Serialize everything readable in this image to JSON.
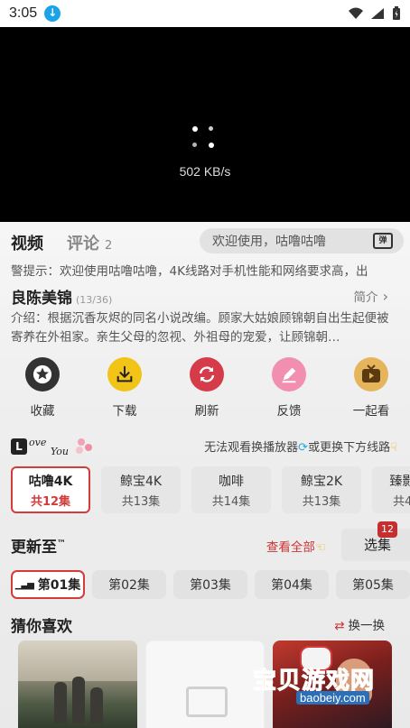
{
  "status_bar": {
    "time": "3:05"
  },
  "player": {
    "speed": "502 KB/s"
  },
  "tabs": {
    "video": "视频",
    "comments": "评论",
    "comments_count": "2"
  },
  "danmu": {
    "placeholder": "欢迎使用，咕噜咕噜",
    "icon_text": "弹"
  },
  "notice": "警提示：欢迎使用咕噜咕噜，4K线路对手机性能和网络要求高，出",
  "show": {
    "title": "良陈美锦",
    "episode_count": "(13/36)",
    "intro_link": "简介",
    "description": "介绍：根据沉香灰烬的同名小说改编。顾家大姑娘顾锦朝自出生起便被寄养在外祖家。亲生父母的忽视、外祖母的宠爱，让顾锦朝…"
  },
  "actions": [
    {
      "label": "收藏",
      "icon": "star-icon",
      "color": "#333333"
    },
    {
      "label": "下载",
      "icon": "download-icon",
      "color": "#f2c418"
    },
    {
      "label": "刷新",
      "icon": "refresh-icon",
      "color": "#d63b4a"
    },
    {
      "label": "反馈",
      "icon": "edit-icon",
      "color": "#f28fb0"
    },
    {
      "label": "一起看",
      "icon": "tv-icon",
      "color": "#e0a238"
    }
  ],
  "brand": {
    "letter": "L",
    "word1": "ove",
    "word2": "You"
  },
  "route_hint": {
    "text1": "无法观看换播放器",
    "text2": "或更换下方线路"
  },
  "routes": [
    {
      "name": "咕噜4K",
      "count": "共12集",
      "active": true
    },
    {
      "name": "鲸宝4K",
      "count": "共13集"
    },
    {
      "name": "咖啡",
      "count": "共14集"
    },
    {
      "name": "鲸宝2K",
      "count": "共13集"
    },
    {
      "name": "臻影...",
      "count": "共4..."
    }
  ],
  "updates": {
    "title": "更新至",
    "tm": "™",
    "view_all": "查看全部",
    "select": "选集",
    "select_badge": "12"
  },
  "episodes": [
    {
      "label": "第01集",
      "active": true
    },
    {
      "label": "第02集"
    },
    {
      "label": "第03集"
    },
    {
      "label": "第04集"
    },
    {
      "label": "第05集"
    }
  ],
  "guess": {
    "title": "猜你喜欢",
    "shuffle": "换一换"
  },
  "watermark": {
    "cn": "宝贝游戏网",
    "url": "baobeiy.com"
  }
}
